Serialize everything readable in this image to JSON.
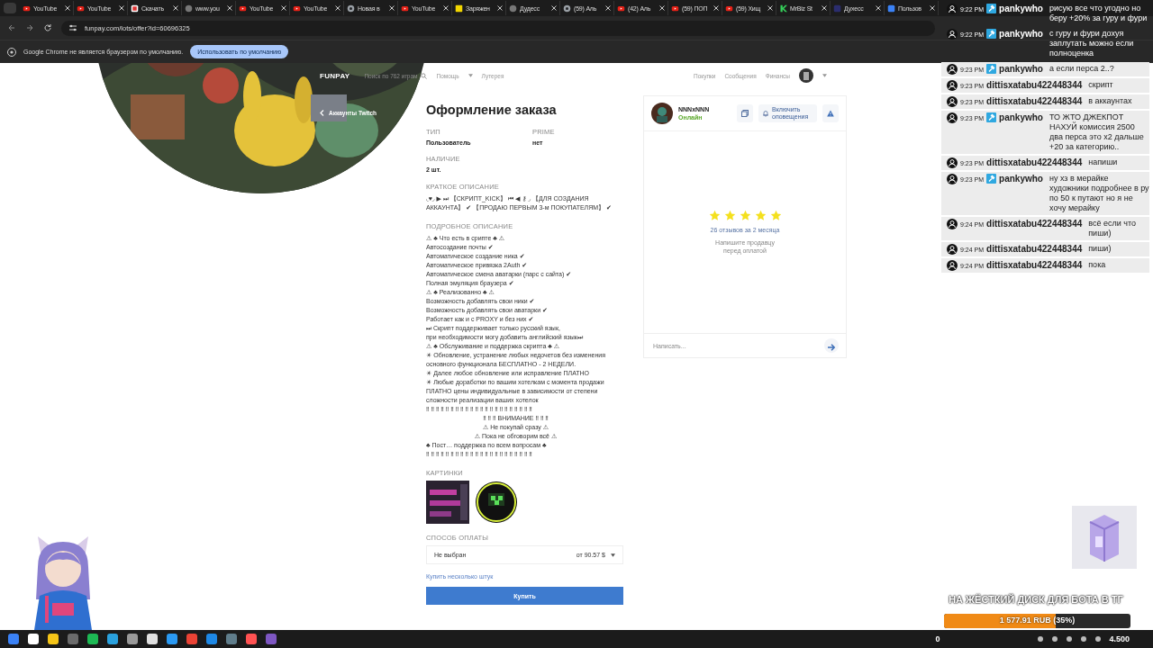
{
  "browser": {
    "tabs": [
      {
        "title": "YouTube",
        "kind": "youtube"
      },
      {
        "title": "YouTube",
        "kind": "youtube"
      },
      {
        "title": "Скачать",
        "kind": "red"
      },
      {
        "title": "www.you",
        "kind": "grey"
      },
      {
        "title": "YouTube",
        "kind": "youtube"
      },
      {
        "title": "YouTube",
        "kind": "youtube"
      },
      {
        "title": "Новая в",
        "kind": "chrome"
      },
      {
        "title": "YouTube",
        "kind": "youtube"
      },
      {
        "title": "Заряжен",
        "kind": "yellow"
      },
      {
        "title": "Дудесс",
        "kind": "grey"
      },
      {
        "title": "(59) Аль",
        "kind": "chrome"
      },
      {
        "title": "(42) Аль",
        "kind": "youtube"
      },
      {
        "title": "(59) ПОП",
        "kind": "youtube"
      },
      {
        "title": "(59) Хищ",
        "kind": "youtube"
      },
      {
        "title": "MrBiz St",
        "kind": "green"
      },
      {
        "title": "Дуxесс",
        "kind": "navy"
      },
      {
        "title": "Пользов",
        "kind": "blue"
      }
    ],
    "url": "funpay.com/lots/offer?id=60696325",
    "infobar": {
      "message": "Google Chrome не является браузером по умолчанию.",
      "button": "Использовать по умолчанию"
    }
  },
  "site": {
    "logo": "FUNPAY",
    "search": {
      "placeholder": "Поиск по 762 играм"
    },
    "nav": [
      "Помощь",
      "Лутерея"
    ],
    "user_nav": [
      "Покупки",
      "Сообщения",
      "Финансы"
    ],
    "back_link": "Аккаунты Twitch"
  },
  "order": {
    "title": "Оформление заказа",
    "fields": [
      {
        "label": "ТИП",
        "value": "Пользователь"
      },
      {
        "label": "PRIME",
        "value": "нет"
      },
      {
        "label": "НАЛИЧИЕ",
        "value": "2 шт."
      }
    ],
    "short_label": "КРАТКОЕ ОПИСАНИЕ",
    "short": "◟♥◞ ▶ ⏭ 【СКРИПТ_KICK】 ⏮ ◀ ⚷ ◞ 【ДЛЯ СОЗДАНИЯ АККАУНТА】 ✔ 【ПРОДАЮ ПЕРВЫМ 3-м ПОКУПАТЕЛЯМ】 ✔",
    "long_label": "ПОДРОБНОЕ ОПИСАНИЕ",
    "lines": [
      {
        "text": "⚠ ♣ Что есть в срипте ♣ ⚠",
        "kind": "plain"
      },
      {
        "text": "Автосоздание почты ✔",
        "kind": "plain"
      },
      {
        "text": "Автоматическое создание ника ✔",
        "kind": "plain"
      },
      {
        "text": "Автоматическое привязка 2Auth ✔",
        "kind": "plain"
      },
      {
        "text": "Автоматическое смена аватарки (парс с сайта) ✔",
        "kind": "plain"
      },
      {
        "text": "Полная эмуляция браузера ✔",
        "kind": "plain"
      },
      {
        "text": "⚠ ♣ Реализованно ♣ ⚠",
        "kind": "plain"
      },
      {
        "text": "Возможность добавлять свои ники ✔",
        "kind": "plain"
      },
      {
        "text": "Возможность добавлять свои аватарки ✔",
        "kind": "plain"
      },
      {
        "text": "Работает как и с PROXY и без них ✔",
        "kind": "plain"
      },
      {
        "text": "⏭ Скрипт поддерживает только русский язык,",
        "kind": "plain"
      },
      {
        "text": "при необходимости могу добавить английский язык⏭",
        "kind": "plain"
      },
      {
        "text": "⚠ ♣ Обслуживание и поддержка скрипта ♣ ⚠",
        "kind": "plain"
      },
      {
        "text": "☀ Обновление, устранение любых недочетов без изменения основного функционала БЕСПЛАТНО - 2 НЕДЕЛИ.",
        "kind": "plain"
      },
      {
        "text": "☀ Далее любое обновление или исправление ПЛАТНО",
        "kind": "plain"
      },
      {
        "text": "☀ Любые доработки по вашим хотелкам с момента продажи ПЛАТНО цены индивидуальные в зависимости от степени сложности реализации ваших хотелок",
        "kind": "plain"
      },
      {
        "text": "‼ ‼ ‼ ‼ ‼ ‼ ‼ ‼ ‼ ‼ ‼ ‼ ‼ ‼ ‼ ‼ ‼ ‼ ‼ ‼ ‼ ‼",
        "kind": "plain"
      },
      {
        "text": "‼ ‼ ‼ ВНИМАНИЕ ‼ ‼ ‼",
        "kind": "centered"
      },
      {
        "text": "⚠ Не покупай сразу ⚠",
        "kind": "centered"
      },
      {
        "text": "⚠ Пока не обговорим всё ⚠",
        "kind": "centered"
      },
      {
        "text": "♣ Пост… поддержка по всем вопросам ♣",
        "kind": "plain"
      },
      {
        "text": "‼ ‼ ‼ ‼ ‼ ‼ ‼ ‼ ‼ ‼ ‼ ‼ ‼ ‼ ‼ ‼ ‼ ‼ ‼ ‼ ‼ ‼",
        "kind": "plain"
      }
    ],
    "pictures_label": "КАРТИНКИ",
    "payment_label": "СПОСОБ ОПЛАТЫ",
    "payment": {
      "value": "Не выбран",
      "price": "от 90.57 $"
    },
    "multi_link": "Купить несколько штук",
    "buy": "Купить"
  },
  "seller": {
    "name": "NNNxNNN",
    "status": "Онлайн",
    "notify": "Включить оповещения",
    "stars": 5,
    "reviews": "26 отзывов за 2 месяца",
    "hint": "Напишите продавцу перед оплатой",
    "message": {
      "placeholder": "Написать..."
    }
  },
  "chat": [
    {
      "time": "9:22 PM",
      "user": "pankywho",
      "moderator": true,
      "text": "рисую все что угодно но беру +20% за гуру и фури"
    },
    {
      "time": "9:22 PM",
      "user": "pankywho",
      "moderator": true,
      "text": "с гуру и фури дохуя заплутать можно если полноценка"
    },
    {
      "time": "9:23 PM",
      "user": "pankywho",
      "moderator": true,
      "text": "а если перса 2..?"
    },
    {
      "time": "9:23 PM",
      "user": "dittisxatabu422448344",
      "moderator": false,
      "text": "скрипт"
    },
    {
      "time": "9:23 PM",
      "user": "dittisxatabu422448344",
      "moderator": false,
      "text": "в аккаунтах"
    },
    {
      "time": "9:23 PM",
      "user": "pankywho",
      "moderator": true,
      "text": "ТО ЖТО ДЖЕКПОТ НАХУЙ комиссия 2500 два перса это х2 дальше +20 за категорию.."
    },
    {
      "time": "9:23 PM",
      "user": "dittisxatabu422448344",
      "moderator": false,
      "text": "напиши"
    },
    {
      "time": "9:23 PM",
      "user": "pankywho",
      "moderator": true,
      "text": "ну хз в мерайке художники подробнее в ру по 50 к путают но я не хочу мерайку"
    },
    {
      "time": "9:24 PM",
      "user": "dittisxatabu422448344",
      "moderator": false,
      "text": "всё если что пиши)"
    },
    {
      "time": "9:24 PM",
      "user": "dittisxatabu422448344",
      "moderator": false,
      "text": "пиши)"
    },
    {
      "time": "9:24 PM",
      "user": "dittisxatabu422448344",
      "moderator": false,
      "text": "пока"
    }
  ],
  "stream_goal": {
    "title": "НА ЖЁСТКИЙ ДИСК ДЛЯ БОТА В ТГ",
    "reading": "1 577.91 RUB (35%)",
    "level": 0.6
  },
  "taskbar": {
    "counter": "0",
    "clock": "4.500"
  }
}
